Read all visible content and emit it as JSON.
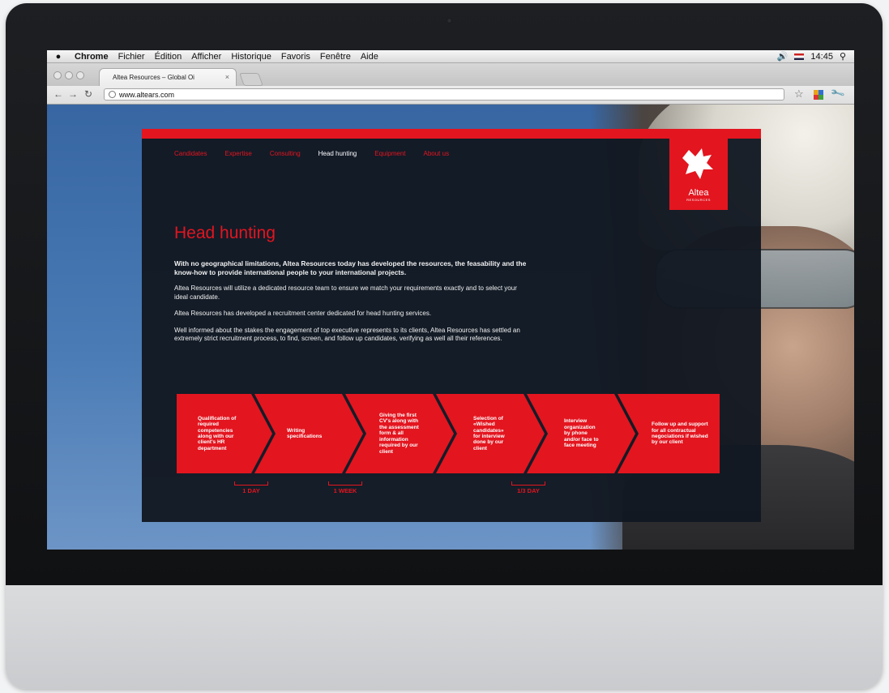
{
  "menubar": {
    "app": "Chrome",
    "items": [
      "Fichier",
      "Édition",
      "Afficher",
      "Historique",
      "Favoris",
      "Fenêtre",
      "Aide"
    ],
    "clock": "14:45"
  },
  "browser": {
    "tab_title": "Altea Resources – Global Oi",
    "url": "www.altears.com"
  },
  "site": {
    "nav": [
      "Candidates",
      "Expertise",
      "Consulting",
      "Head hunting",
      "Equipment",
      "About us"
    ],
    "active_nav": "Head hunting",
    "logo_name": "Altea",
    "logo_sub": "RESOURCES",
    "title": "Head hunting",
    "lead": "With no geographical limitations, Altea Resources today has developed the resources, the feasability and the know-how to provide international people to your international projects.",
    "paragraphs": [
      "Altea Resources will utilize a dedicated resource team to ensure we match your requirements exactly and to select your ideal candidate.",
      "Altea Resources has developed a recruitment center dedicated for head hunting services.",
      "Well informed about the stakes  the engagement of top executive represents to its clients, Altea Resources has settled an extremely strict recruitment process, to find, screen, and follow up candidates, verifying  as well all their references."
    ],
    "steps": [
      "Qualification of required competencies along with our client's HR department",
      "Writing specifications",
      "Giving the first CV's along with the assessment form & all information required by our client",
      "Selection of «Wished candidates» for interview done by our client",
      "Interview organization by phone and/or face to face meeting",
      "Follow up and support for all contractual negociations if wished by our client"
    ],
    "durations": [
      "1 DAY",
      "1 WEEK",
      "1/3 DAY"
    ]
  },
  "colors": {
    "brand_red": "#e3151f",
    "panel_dark": "#121821",
    "sky_blue": "#3f6ba6"
  }
}
